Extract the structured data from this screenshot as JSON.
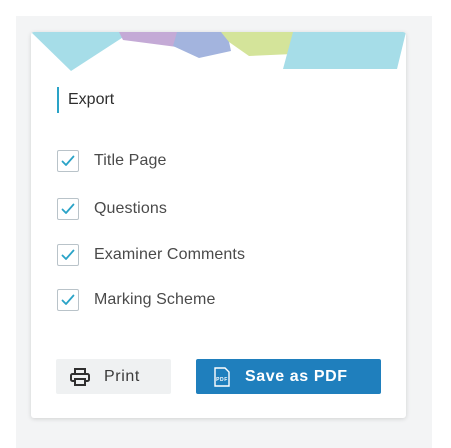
{
  "dialog": {
    "title": "Export",
    "options": [
      {
        "label": "Title Page",
        "checked": true
      },
      {
        "label": "Questions",
        "checked": true
      },
      {
        "label": "Examiner Comments",
        "checked": true
      },
      {
        "label": "Marking Scheme",
        "checked": true
      }
    ],
    "print_label": "Print",
    "save_pdf_label": "Save as PDF",
    "pdf_icon_text": "PDF"
  },
  "icons": {
    "checkbox": "check-icon",
    "print": "printer-icon",
    "pdf": "pdf-file-icon"
  },
  "colors": {
    "accent": "#2aa3c7",
    "primary_button": "#1f7fbd",
    "secondary_button": "#eff1f2",
    "banner_cyan": "#a6dde8",
    "banner_violet": "#c4aad6",
    "banner_blue": "#a3b4de",
    "banner_lime": "#d4e49a"
  }
}
